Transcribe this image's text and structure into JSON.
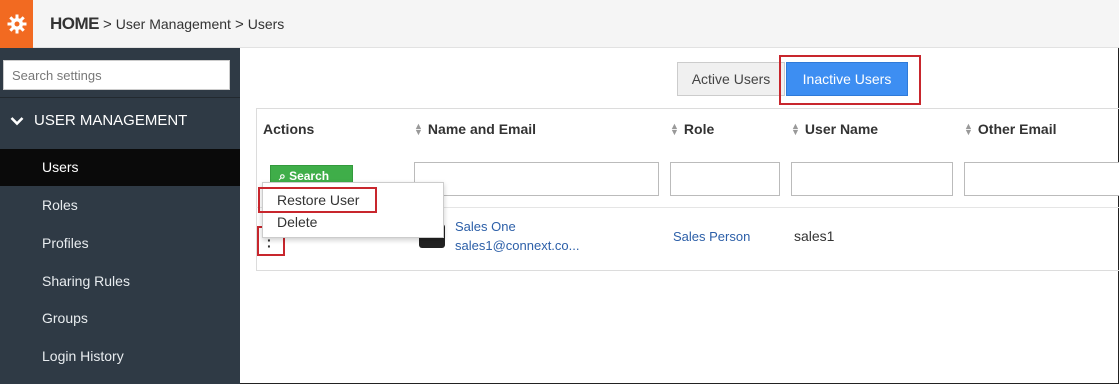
{
  "header": {
    "breadcrumb": [
      "HOME",
      "User Management",
      "Users"
    ],
    "separator": ">"
  },
  "sidebar": {
    "search_placeholder": "Search settings",
    "section_label": "USER MANAGEMENT",
    "items": [
      {
        "label": "Users",
        "active": true
      },
      {
        "label": "Roles"
      },
      {
        "label": "Profiles"
      },
      {
        "label": "Sharing Rules"
      },
      {
        "label": "Groups"
      },
      {
        "label": "Login History"
      }
    ]
  },
  "toggle": {
    "active_label": "Active Users",
    "inactive_label": "Inactive Users",
    "selected": "Inactive Users"
  },
  "table": {
    "columns": [
      "Actions",
      "Name and Email",
      "Role",
      "User Name",
      "Other Email"
    ],
    "search_button": "Search",
    "rows": [
      {
        "name": "Sales One",
        "email": "sales1@connext.co...",
        "role": "Sales Person",
        "username": "sales1",
        "other_email": ""
      }
    ]
  },
  "context_menu": {
    "items": [
      "Restore User",
      "Delete"
    ]
  },
  "colors": {
    "accent_orange": "#f26a21",
    "sidebar_bg": "#2f3a45",
    "primary_blue": "#3d8ef2",
    "search_green": "#3fae49",
    "highlight_red": "#c8262d",
    "link_blue": "#2c5fa8"
  }
}
